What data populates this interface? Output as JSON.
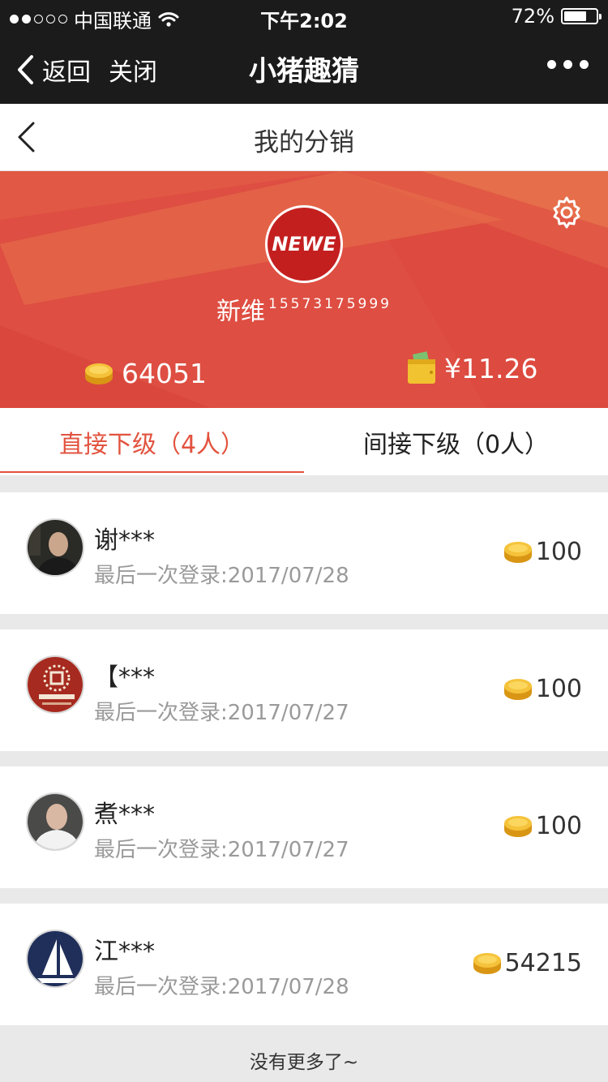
{
  "status_bar": {
    "carrier": "中国联通",
    "time": "下午2:02",
    "battery": "72%",
    "battery_level": 0.72
  },
  "nav": {
    "back_label": "返回",
    "close_label": "关闭",
    "title": "小猪趣猜"
  },
  "page": {
    "title": "我的分销"
  },
  "profile": {
    "logo_text": "NEWE",
    "name": "新维",
    "phone": "15573175999",
    "coins": "64051",
    "balance": "¥11.26"
  },
  "tabs": [
    {
      "label": "直接下级（4人）",
      "active": true
    },
    {
      "label": "间接下级（0人）",
      "active": false
    }
  ],
  "members": [
    {
      "name": "谢***",
      "last_login": "最后一次登录:2017/07/28",
      "coins": "100"
    },
    {
      "name": "【***",
      "last_login": "最后一次登录:2017/07/27",
      "coins": "100"
    },
    {
      "name": "煮***",
      "last_login": "最后一次登录:2017/07/27",
      "coins": "100"
    },
    {
      "name": "江***",
      "last_login": "最后一次登录:2017/07/28",
      "coins": "54215"
    }
  ],
  "footer_text": "没有更多了~",
  "colors": {
    "accent": "#e2533f",
    "banner": "#dd4a3f",
    "navbar": "#1b1b1b",
    "coin": "#f2b52c"
  },
  "icons": {
    "settings": "gear-icon",
    "coin": "coin-icon",
    "wallet": "wallet-icon",
    "back": "chevron-left-icon",
    "more": "more-icon"
  }
}
